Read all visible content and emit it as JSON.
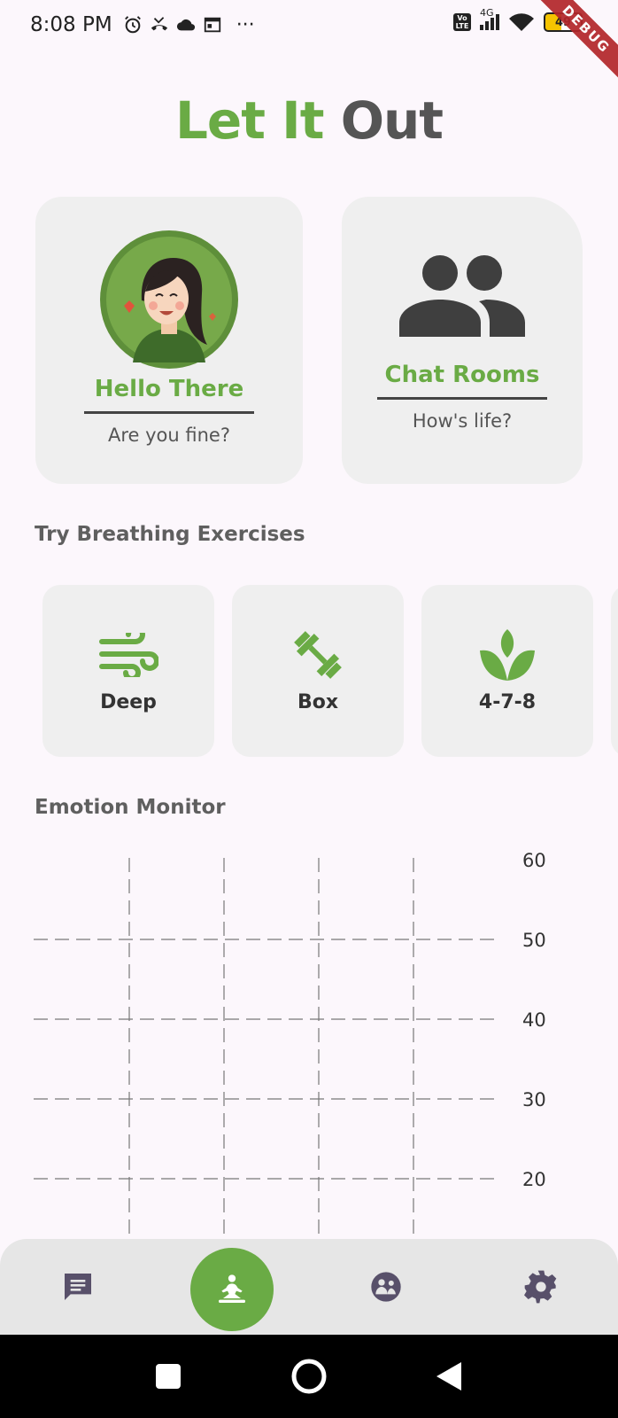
{
  "status_bar": {
    "time": "8:08 PM",
    "more": "···",
    "network_label": "4G",
    "volte_label": "Vo LTE",
    "battery_level": "49"
  },
  "debug_banner": "DEBUG",
  "app_title": {
    "part1": "Let It",
    "part2": "Out"
  },
  "cards": [
    {
      "title": "Hello There",
      "subtitle": "Are you fine?",
      "icon": "avatar-icon"
    },
    {
      "title": "Chat Rooms",
      "subtitle": "How's life?",
      "icon": "group-icon"
    }
  ],
  "breathing": {
    "title": "Try Breathing Exercises",
    "items": [
      {
        "label": "Deep",
        "icon": "wind-icon"
      },
      {
        "label": "Box",
        "icon": "dumbbell-icon"
      },
      {
        "label": "4-7-8",
        "icon": "lotus-icon"
      }
    ]
  },
  "emotion_monitor": {
    "title": "Emotion Monitor"
  },
  "chart_data": {
    "type": "line",
    "title": "",
    "xlabel": "",
    "ylabel": "",
    "y_tick_labels": [
      "60",
      "50",
      "40",
      "30",
      "20"
    ],
    "ylim": [
      10,
      60
    ],
    "grid": true,
    "series": []
  },
  "bottom_nav": [
    {
      "name": "chat-icon",
      "active": false
    },
    {
      "name": "meditation-icon",
      "active": true
    },
    {
      "name": "community-icon",
      "active": false
    },
    {
      "name": "settings-icon",
      "active": false
    }
  ],
  "colors": {
    "accent": "#6AAB45",
    "background": "#FCF7FC",
    "card": "#EFEFEF",
    "nav": "#E6E6E6",
    "icon_dark": "#58506A"
  }
}
